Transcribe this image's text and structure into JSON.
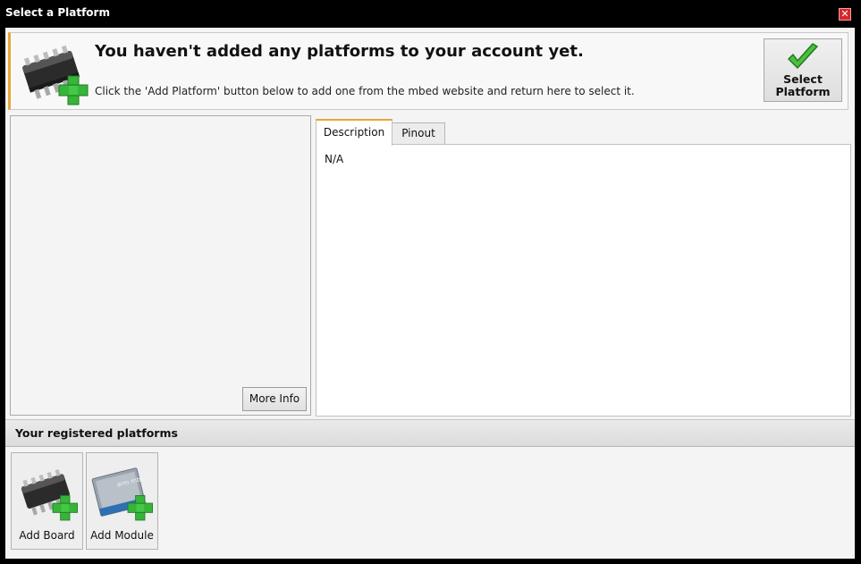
{
  "window": {
    "title": "Select a Platform",
    "close_icon": "close-icon",
    "close_glyph": "✕"
  },
  "banner": {
    "icon": "chip-add-icon",
    "heading": "You haven't added any platforms to your account yet.",
    "subtext": "Click the 'Add Platform' button below to add one from the mbed website and return here to select it.",
    "accent_color": "#e8a63a"
  },
  "select_button": {
    "icon": "checkmark-icon",
    "label_line1": "Select",
    "label_line2": "Platform"
  },
  "left_panel": {
    "more_info_label": "More Info"
  },
  "tabs": [
    {
      "label": "Description",
      "active": true
    },
    {
      "label": "Pinout",
      "active": false
    }
  ],
  "description": {
    "text": "N/A"
  },
  "registered": {
    "header": "Your registered platforms",
    "tiles": [
      {
        "label": "Add Board",
        "icon": "chip-add-icon"
      },
      {
        "label": "Add Module",
        "icon": "module-add-icon",
        "module_text": "arm mbed Enabled"
      }
    ]
  }
}
